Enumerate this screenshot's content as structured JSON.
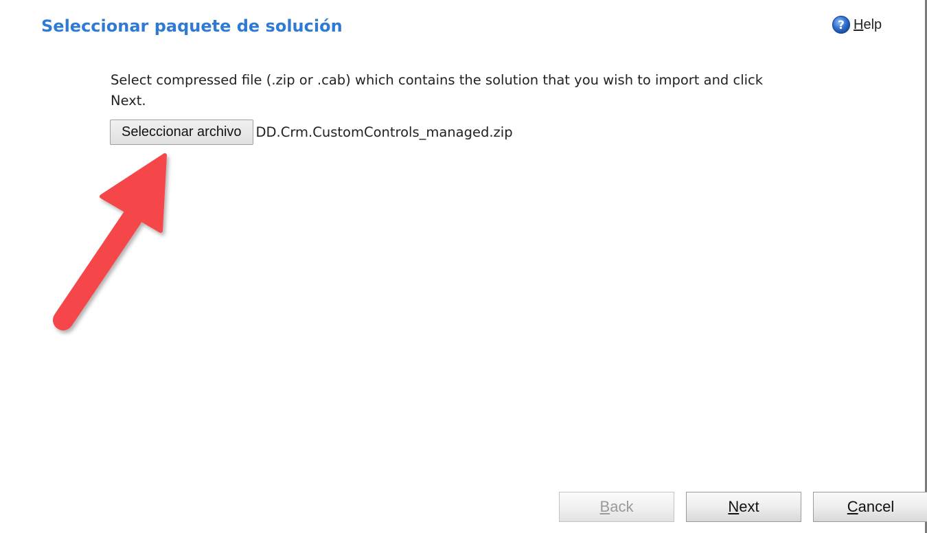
{
  "header": {
    "title": "Seleccionar paquete de solución",
    "help_first_letter": "H",
    "help_rest": "elp",
    "help_icon": "help-question-circle-icon"
  },
  "content": {
    "instructions": "Select compressed file (.zip or .cab) which contains the solution that you wish to import and click Next.",
    "file_button_label": "Seleccionar archivo",
    "selected_file_name": "DD.Crm.CustomControls_managed.zip"
  },
  "footer": {
    "back": {
      "first_letter": "B",
      "rest": "ack",
      "enabled": false
    },
    "next": {
      "first_letter": "N",
      "rest": "ext",
      "enabled": true
    },
    "cancel": {
      "first_letter": "C",
      "rest": "ancel",
      "enabled": true
    }
  },
  "annotation": {
    "arrow_color": "#f5464a"
  },
  "colors": {
    "title": "#2f7bd3",
    "help_icon": "#2f6fcf"
  }
}
